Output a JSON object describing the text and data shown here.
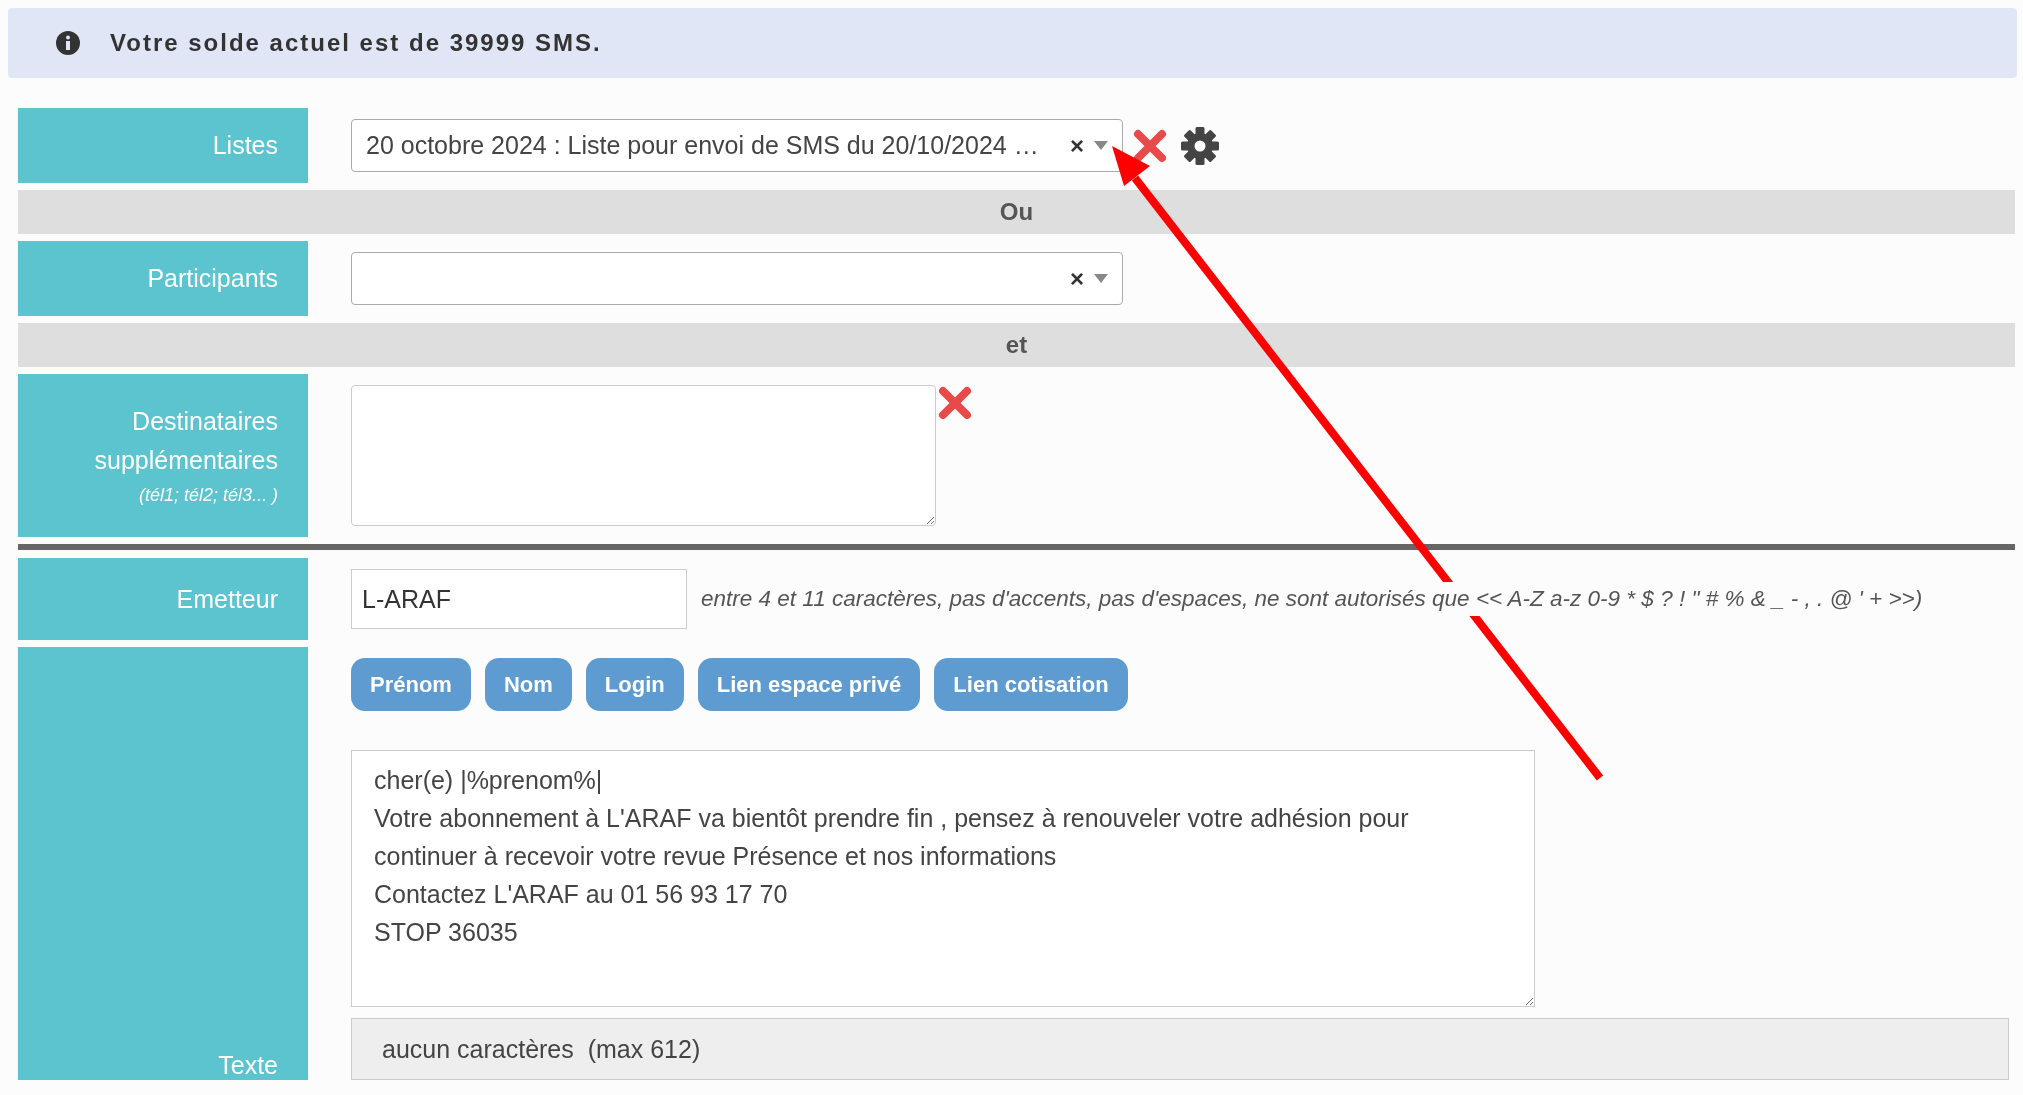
{
  "alert": {
    "text": "Votre solde actuel est de 39999 SMS."
  },
  "rows": [
    {
      "kind": "select",
      "label": "Listes",
      "value": "20 octobre 2024 : Liste pour envoi de SMS du 20/10/2024 …",
      "clear_symbol": "×",
      "delete": true,
      "settings": true
    },
    {
      "kind": "separator",
      "label": "Ou"
    },
    {
      "kind": "select",
      "label": "Participants",
      "clear_symbol": "×"
    },
    {
      "kind": "separator",
      "label": "et"
    },
    {
      "kind": "textarea",
      "label": "Destinataires supplémentaires",
      "hint": "(tél1; tél2; tél3... )",
      "delete": true
    },
    {
      "kind": "divider"
    },
    {
      "kind": "input",
      "label": "Emetteur",
      "value": "L-ARAF",
      "help": "entre 4 et 11 caractères, pas d'accents, pas d'espaces, ne sont autorisés que << A-Z a-z 0-9 * $ ? ! \" # % & _ - , . @ ' + >>)"
    },
    {
      "kind": "message",
      "label": "Texte",
      "buttons": [
        "Prénom",
        "Nom",
        "Login",
        "Lien espace privé",
        "Lien cotisation"
      ],
      "value": "cher(e) |%prenom%|\nVotre abonnement à L'ARAF va bientôt prendre fin , pensez à renouveler votre adhésion pour continuer à recevoir votre revue Présence et nos informations\nContactez L'ARAF au 01 56 93 17 70\nSTOP 36035",
      "counter": "aucun caractères  (max 612)"
    }
  ],
  "annotation": {
    "kind": "arrow"
  }
}
